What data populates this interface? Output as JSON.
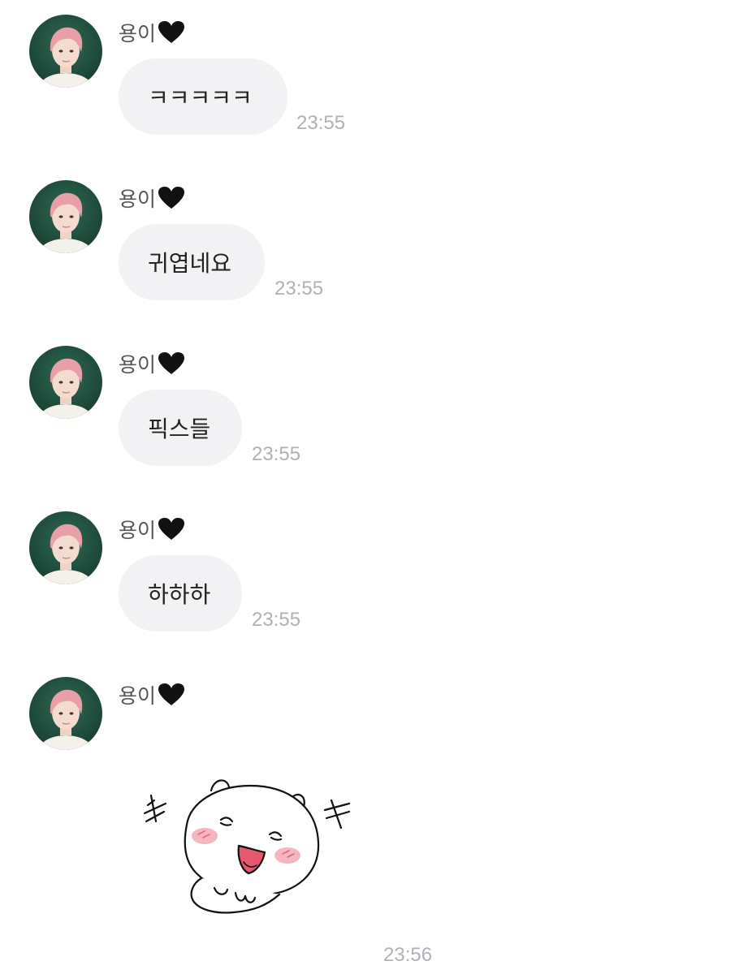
{
  "sender_name": "용이",
  "sender_emoji": "🖤",
  "messages": [
    {
      "text": "ㅋㅋㅋㅋㅋ",
      "time": "23:55"
    },
    {
      "text": "귀엽네요",
      "time": "23:55"
    },
    {
      "text": "픽스들",
      "time": "23:55"
    },
    {
      "text": "하하하",
      "time": "23:55"
    }
  ],
  "sticker": {
    "kind": "laughing-hamster-sticker",
    "time": "23:56"
  },
  "colors": {
    "bubble": "#f2f2f5",
    "timestamp": "#b0b0b6",
    "sender": "#555555",
    "avatar_bg": "#1f4a3a",
    "hair": "#e8a0a8"
  }
}
